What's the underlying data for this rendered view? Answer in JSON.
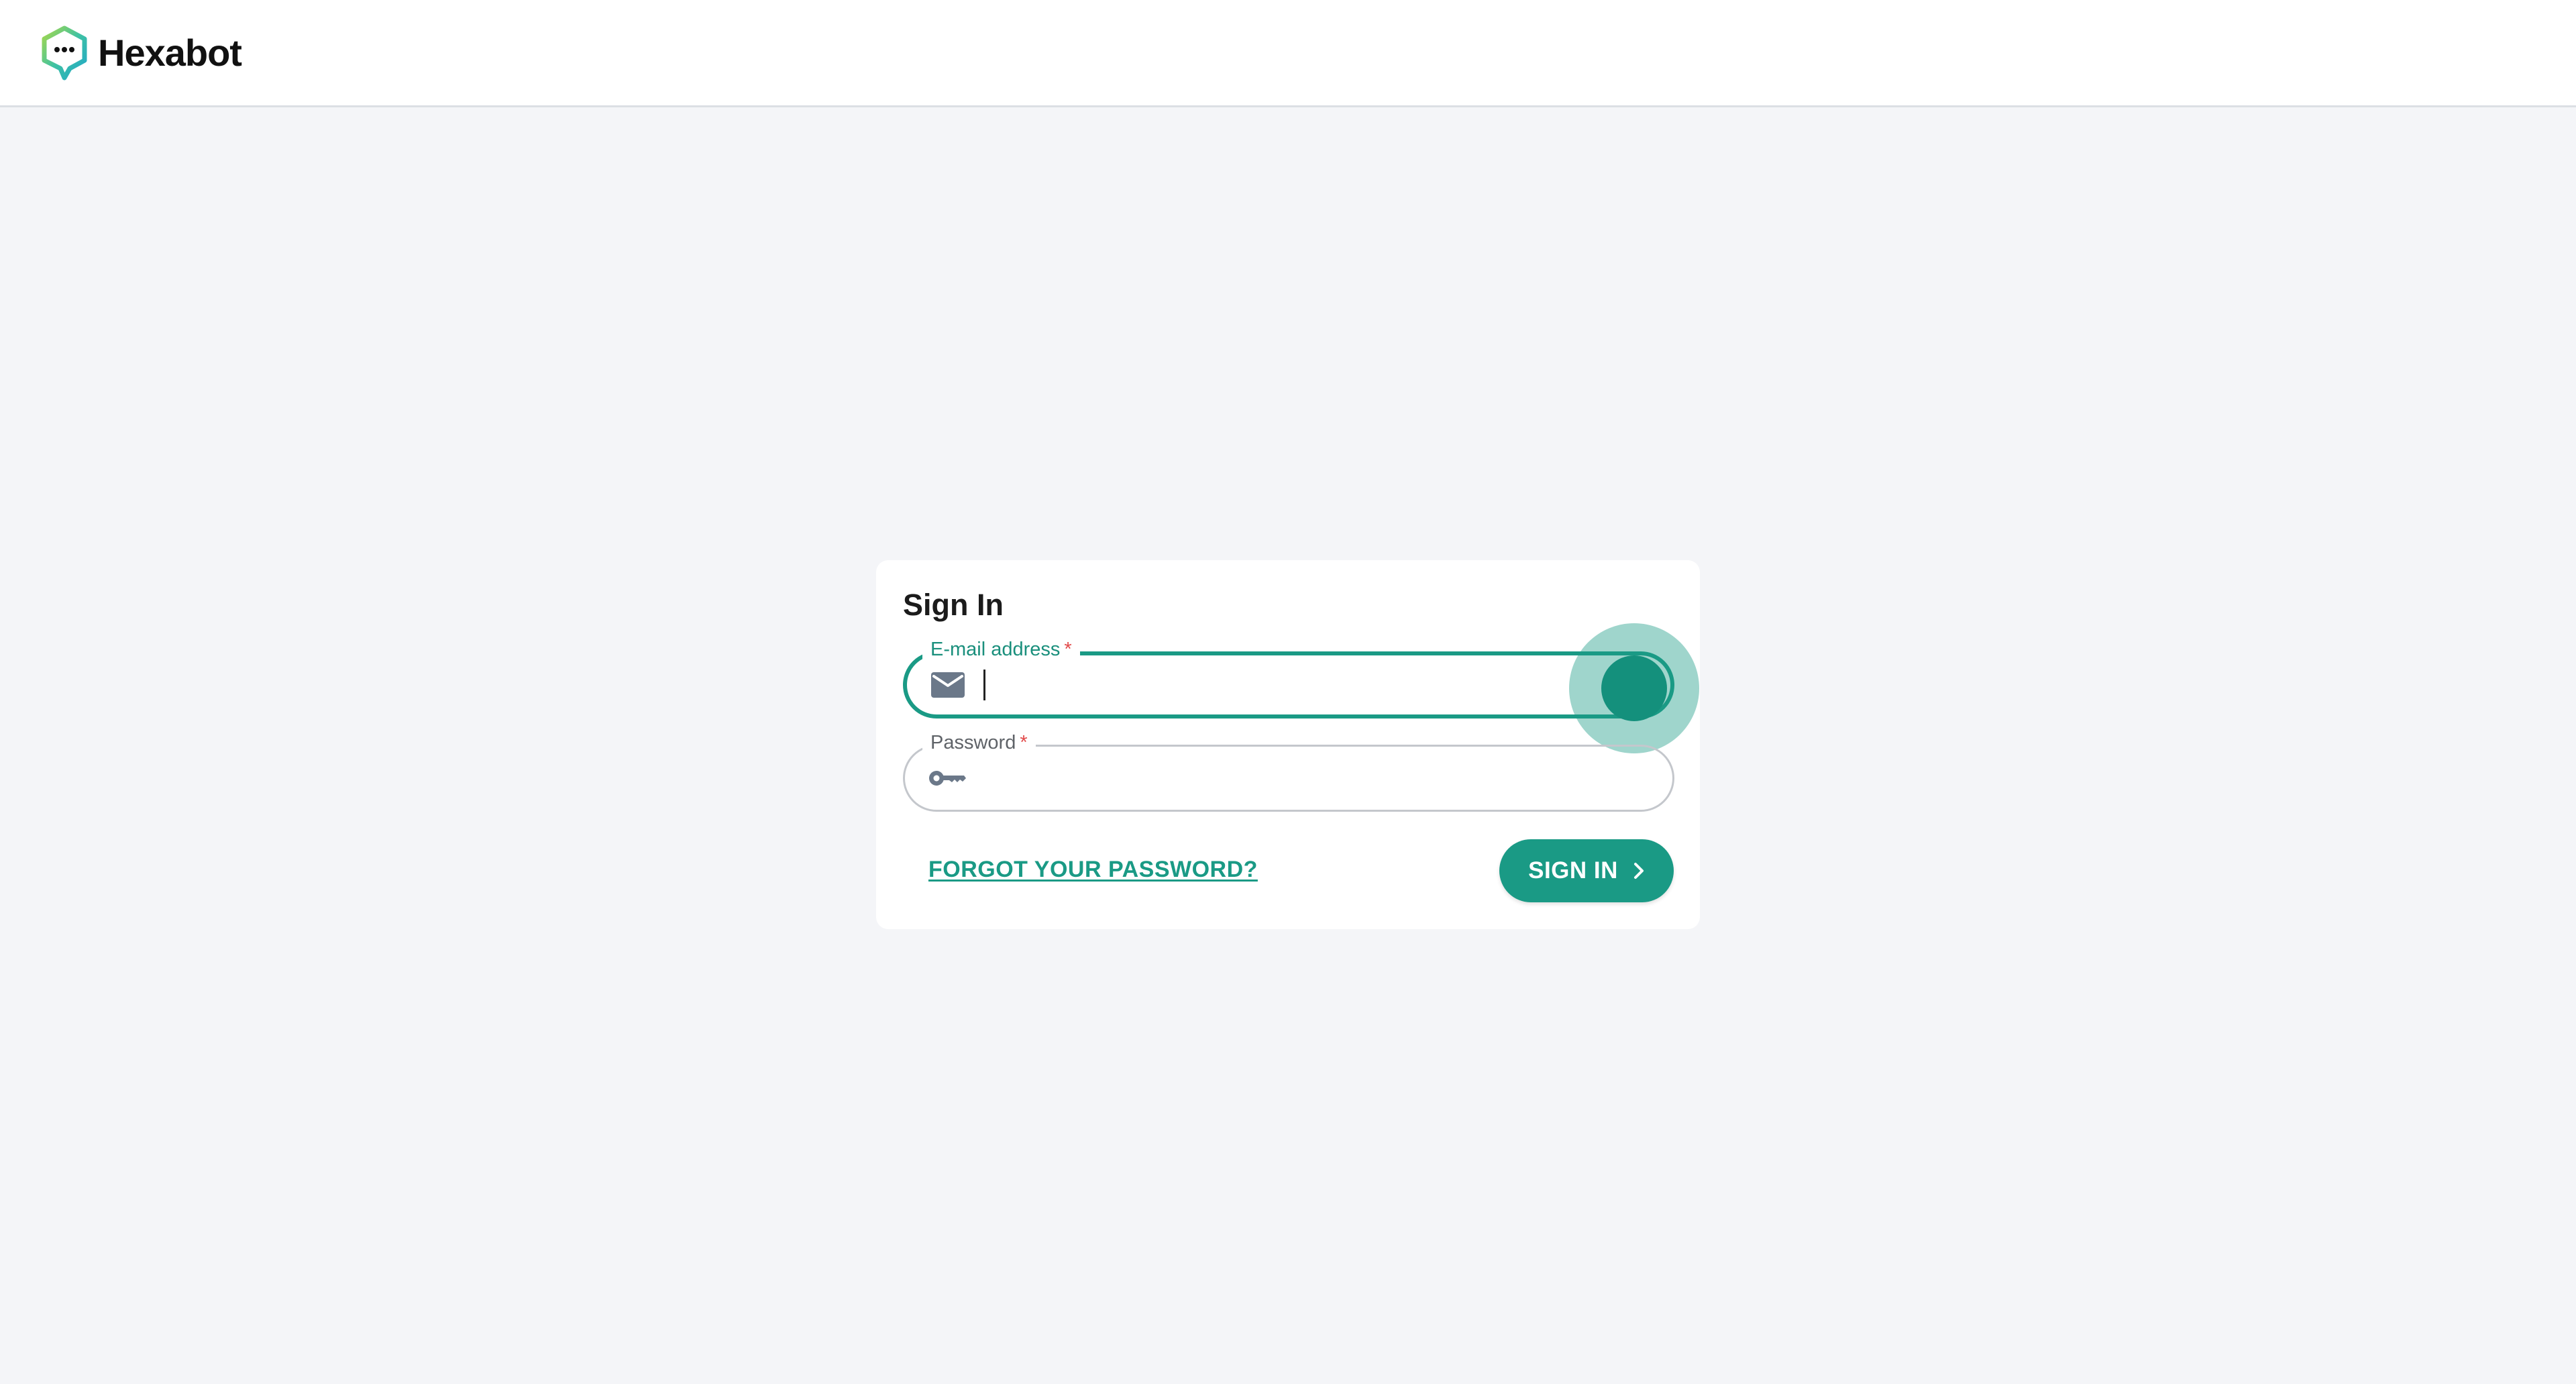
{
  "header": {
    "brand_name": "Hexabot",
    "logo_icon": "hexabot-logo-icon"
  },
  "login": {
    "title": "Sign In",
    "email_field": {
      "label": "E-mail address",
      "required_mark": "*",
      "value": "",
      "icon": "mail-icon"
    },
    "password_field": {
      "label": "Password",
      "required_mark": "*",
      "value": "",
      "icon": "key-icon"
    },
    "forgot_password_label": "FORGOT YOUR PASSWORD?",
    "sign_in_label": "SIGN IN",
    "sign_in_icon": "chevron-right-icon"
  },
  "colors": {
    "accent": "#1a9a85",
    "background": "#f4f5f8",
    "card": "#ffffff",
    "required": "#e24b4b",
    "icon": "#6b7889"
  }
}
